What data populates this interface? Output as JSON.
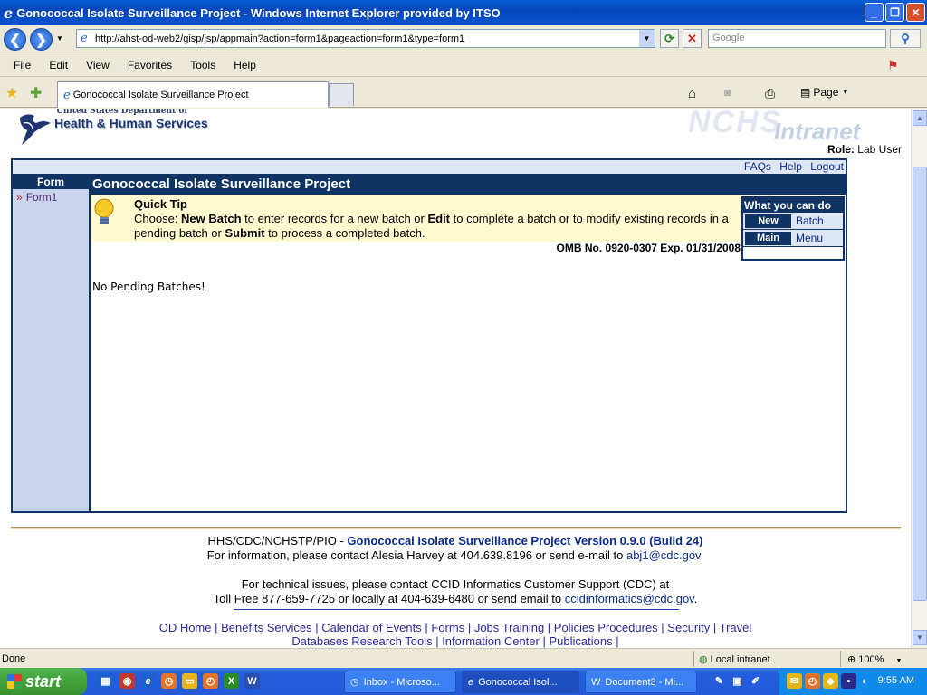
{
  "window": {
    "title": "Gonococcal Isolate Surveillance Project - Windows Internet Explorer provided by ITSO",
    "min": "_",
    "max": "❐",
    "close": "✕"
  },
  "toolbar": {
    "back": "❮",
    "forward": "❯",
    "url": "http://ahst-od-web2/gisp/jsp/appmain?action=form1&pageaction=form1&type=form1",
    "search_placeholder": "Google",
    "refresh": "⟳",
    "stop": "✕",
    "search_go": "⚲"
  },
  "menu": [
    "File",
    "Edit",
    "View",
    "Favorites",
    "Tools",
    "Help"
  ],
  "tab": {
    "title": "Gonococcal Isolate Surveillance Project"
  },
  "commandbar": {
    "page": "Page"
  },
  "header": {
    "agency_small": "United States Department of",
    "agency": "Health & Human Services",
    "intranet": "Intranet",
    "role_label": "Role:",
    "role_value": "Lab User"
  },
  "topnav": [
    "FAQs",
    "Help",
    "Logout"
  ],
  "leftnav": {
    "header": "Form",
    "items": [
      "Form1"
    ]
  },
  "main": {
    "title": "Gonococcal Isolate Surveillance Project",
    "tip_title": "Quick Tip",
    "tip_parts": {
      "p1": "Choose: ",
      "b1": "New Batch",
      "p2": " to enter records for a new batch or ",
      "b2": "Edit",
      "p3": " to complete a batch or to modify existing records in a pending batch or ",
      "b3": "Submit",
      "p4": " to process a completed batch."
    },
    "omb": "OMB No. 0920-0307 Exp. 01/31/2008",
    "empty_message": "No Pending Batches!"
  },
  "whatyoucando": {
    "header": "What you can do",
    "rows": [
      {
        "key": "New",
        "value": "Batch"
      },
      {
        "key": "Main",
        "value": "Menu"
      }
    ]
  },
  "footer": {
    "line1_prefix": "HHS/CDC/NCHSTP/PIO - ",
    "line1_app": "Gonococcal Isolate Surveillance Project Version 0.9.0 (Build 24)",
    "line2_prefix": "For information, please contact Alesia Harvey at 404.639.8196 or send e-mail to ",
    "line2_email": "abj1@cdc.gov",
    "line2_suffix": ".",
    "line3": "For technical issues, please contact CCID Informatics Customer Support (CDC) at",
    "line4_prefix": "Toll Free 877-659-7725 or locally at 404-639-6480 or send email to ",
    "line4_email": "ccidinformatics@cdc.gov",
    "line4_suffix": ".",
    "links_row1": [
      "OD Home",
      "Benefits",
      "Services",
      "Calendar of Events",
      "Forms",
      "Jobs",
      "Training",
      "Policies",
      "Procedures",
      "Security",
      "Travel"
    ],
    "links_row2": [
      "Databases",
      "Research Tools",
      "Information Center",
      "Publications"
    ]
  },
  "statusbar": {
    "status": "Done",
    "zone": "Local intranet",
    "zoom": "100%"
  },
  "taskbar": {
    "start": "start",
    "items": [
      "Inbox - Microso...",
      "Gonococcal Isol...",
      "Document3 - Mi..."
    ],
    "clock": "9:55 AM"
  },
  "colors": {
    "navy": "#0f3463",
    "tip_bg": "#fdfbcf",
    "left_bg": "#c8d5ec"
  }
}
